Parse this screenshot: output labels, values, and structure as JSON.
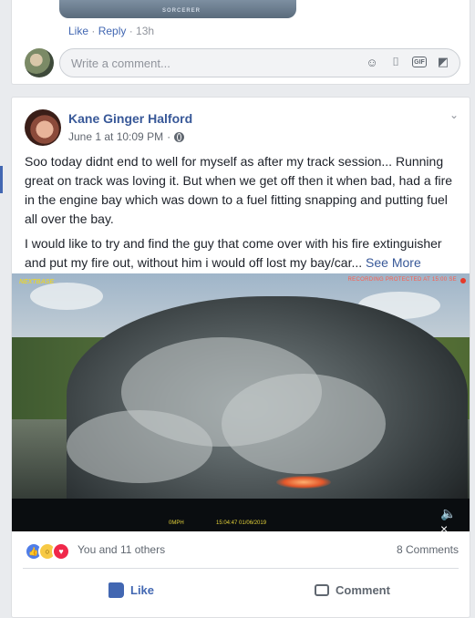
{
  "previous_post": {
    "image_caption": "SORCERER",
    "comment_actions": {
      "like": "Like",
      "separator1": " · ",
      "reply": "Reply",
      "separator2": " · ",
      "time": "13h"
    },
    "comment_input": {
      "placeholder": "Write a comment..."
    },
    "comment_icons": [
      "emoji-icon",
      "camera-icon",
      "gif-icon",
      "sticker-icon"
    ]
  },
  "post": {
    "author": "Kane Ginger Halford",
    "date": "June 1 at 10:09 PM",
    "date_separator": " · ",
    "paragraph1": "Soo today didnt end to well for myself as after my track session... Running great on track was loving it. But when we get off then it when bad, had a fire in the engine bay which was down to a fuel fitting snapping and putting fuel all over the bay.",
    "paragraph2": "I would like to try and find the guy that come over with his fire extinguisher and put my fire out, without him i would off lost my bay/car...",
    "see_more": "See More",
    "video": {
      "cam_logo": "NEXTBASE",
      "recording": "RECORDING PROTECTED AT 15:00 SE",
      "speed": "0MPH",
      "timestamp": "15:04:47 01/06/2019"
    },
    "reactions": {
      "types": [
        "like",
        "wow",
        "love"
      ],
      "summary": "You and 11 others",
      "comments": "8 Comments"
    },
    "actions": {
      "like": "Like",
      "comment": "Comment"
    }
  },
  "colors": {
    "link_blue": "#385898",
    "action_blue": "#4267b2",
    "background": "#e9ebee"
  }
}
